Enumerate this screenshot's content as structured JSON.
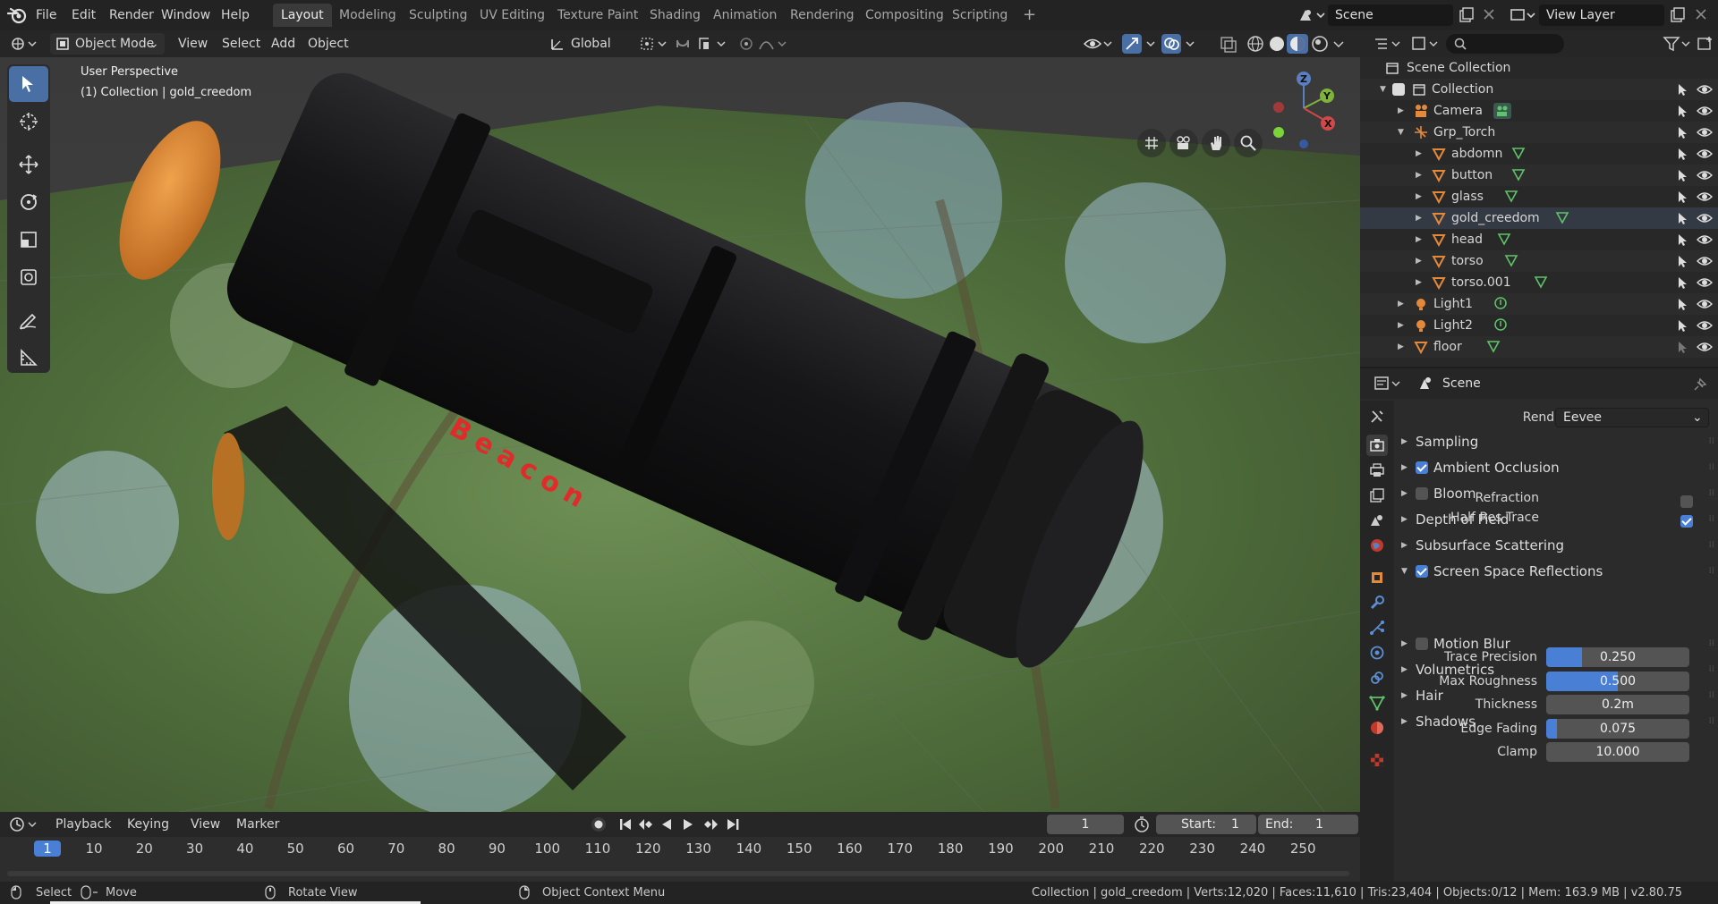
{
  "topbar": {
    "menus": [
      "File",
      "Edit",
      "Render",
      "Window",
      "Help"
    ],
    "workspaces": [
      "Layout",
      "Modeling",
      "Sculpting",
      "UV Editing",
      "Texture Paint",
      "Shading",
      "Animation",
      "Rendering",
      "Compositing",
      "Scripting"
    ],
    "active_workspace": "Layout",
    "add_tab": "+",
    "scene_name": "Scene",
    "view_layer": "View Layer"
  },
  "viewport_header": {
    "mode": "Object Mode",
    "menus": [
      "View",
      "Select",
      "Add",
      "Object"
    ],
    "transform_orientation": "Global"
  },
  "viewport": {
    "perspective_label": "User Perspective",
    "collection_label": "(1) Collection | gold_creedom",
    "gizmo_axes": [
      "Z",
      "Y",
      "X"
    ],
    "model_text": "Beacon"
  },
  "outliner": {
    "root": "Scene Collection",
    "rows": [
      {
        "name": "Collection",
        "indent": 0,
        "icon": "collection"
      },
      {
        "name": "Camera",
        "indent": 1,
        "icon": "camera"
      },
      {
        "name": "Grp_Torch",
        "indent": 1,
        "icon": "empty"
      },
      {
        "name": "abdomn",
        "indent": 2,
        "icon": "mesh"
      },
      {
        "name": "button",
        "indent": 2,
        "icon": "mesh"
      },
      {
        "name": "glass",
        "indent": 2,
        "icon": "mesh"
      },
      {
        "name": "gold_creedom",
        "indent": 2,
        "icon": "mesh"
      },
      {
        "name": "head",
        "indent": 2,
        "icon": "mesh"
      },
      {
        "name": "torso",
        "indent": 2,
        "icon": "mesh"
      },
      {
        "name": "torso.001",
        "indent": 2,
        "icon": "mesh"
      },
      {
        "name": "Light1",
        "indent": 1,
        "icon": "light"
      },
      {
        "name": "Light2",
        "indent": 1,
        "icon": "light"
      },
      {
        "name": "floor",
        "indent": 1,
        "icon": "mesh"
      }
    ]
  },
  "properties": {
    "context": "Scene",
    "render_engine_label": "Render Engine",
    "render_engine": "Eevee",
    "panels": [
      {
        "label": "Sampling",
        "checkbox": null,
        "open": false
      },
      {
        "label": "Ambient Occlusion",
        "checkbox": true,
        "open": false
      },
      {
        "label": "Bloom",
        "checkbox": false,
        "open": false
      },
      {
        "label": "Depth of Field",
        "checkbox": null,
        "open": false
      },
      {
        "label": "Subsurface Scattering",
        "checkbox": null,
        "open": false
      },
      {
        "label": "Screen Space Reflections",
        "checkbox": true,
        "open": true
      }
    ],
    "ssr": {
      "refraction_label": "Refraction",
      "refraction": false,
      "half_res_label": "Half Res Trace",
      "half_res": true,
      "trace_precision_label": "Trace Precision",
      "trace_precision": "0.250",
      "trace_precision_fill": 0.25,
      "max_roughness_label": "Max Roughness",
      "max_roughness": "0.500",
      "max_roughness_fill": 0.5,
      "thickness_label": "Thickness",
      "thickness": "0.2m",
      "thickness_fill": 0,
      "edge_fading_label": "Edge Fading",
      "edge_fading": "0.075",
      "edge_fading_fill": 0.075,
      "clamp_label": "Clamp",
      "clamp": "10.000",
      "clamp_fill": 0
    },
    "panels_after": [
      {
        "label": "Motion Blur",
        "checkbox": false
      },
      {
        "label": "Volumetrics",
        "checkbox": null
      },
      {
        "label": "Hair",
        "checkbox": null
      },
      {
        "label": "Shadows",
        "checkbox": null
      }
    ]
  },
  "timeline": {
    "menus": [
      "Playback",
      "Keying",
      "View",
      "Marker"
    ],
    "current_frame": "1",
    "start_label": "Start:",
    "start": "1",
    "end_label": "End:",
    "end": "1",
    "ticks": [
      "1",
      "10",
      "20",
      "30",
      "40",
      "50",
      "60",
      "70",
      "80",
      "90",
      "100",
      "110",
      "120",
      "130",
      "140",
      "150",
      "160",
      "170",
      "180",
      "190",
      "200",
      "210",
      "220",
      "230",
      "240",
      "250"
    ]
  },
  "statusbar": {
    "select": "Select",
    "move": "Move",
    "rotate": "Rotate View",
    "context_menu": "Object Context Menu",
    "stats": "Collection | gold_creedom | Verts:12,020 | Faces:11,610 | Tris:23,404 | Objects:0/12 | Mem: 163.9 MB | v2.80.75"
  },
  "colors": {
    "accent": "#4a7fd6",
    "orange": "#e08a3a",
    "mesh_icon": "#e4893a",
    "green_icon": "#5ec46a"
  }
}
